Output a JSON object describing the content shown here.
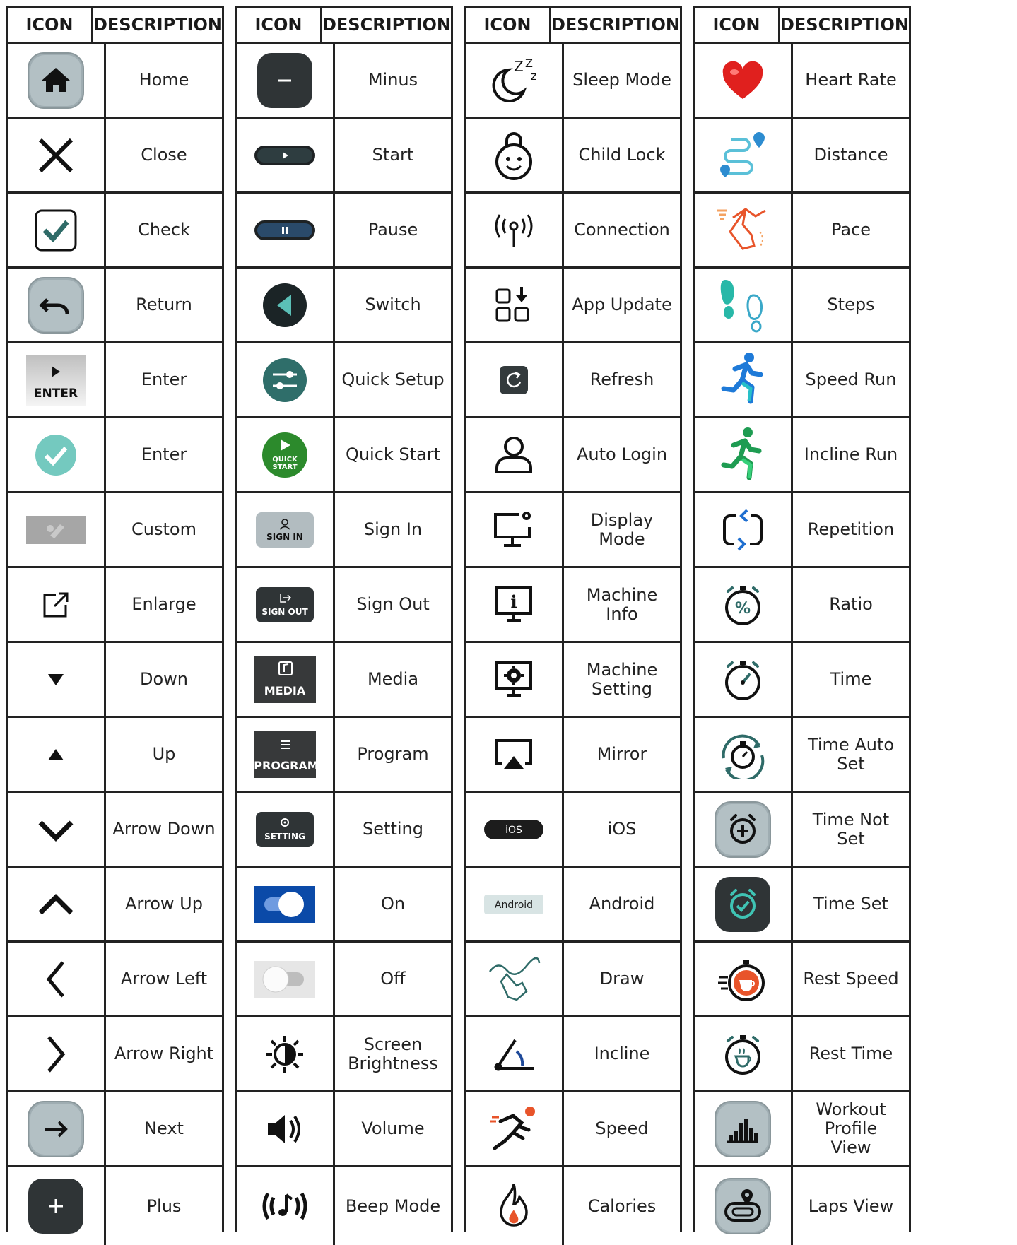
{
  "header": {
    "icon_label": "ICON",
    "description_label": "DESCRIPTION"
  },
  "colors": {
    "border": "#222222",
    "teal": "#2f6b68",
    "dark": "#333a3c",
    "grey_button": "#a7b3b7"
  },
  "columns": [
    {
      "rows": [
        {
          "icon": "home-icon",
          "label": "Home"
        },
        {
          "icon": "close-icon",
          "label": "Close"
        },
        {
          "icon": "check-icon",
          "label": "Check"
        },
        {
          "icon": "return-icon",
          "label": "Return"
        },
        {
          "icon": "enter-button-icon",
          "label": "Enter",
          "icon_text": "ENTER"
        },
        {
          "icon": "enter-check-icon",
          "label": "Enter"
        },
        {
          "icon": "custom-icon",
          "label": "Custom"
        },
        {
          "icon": "enlarge-icon",
          "label": "Enlarge"
        },
        {
          "icon": "down-triangle-icon",
          "label": "Down"
        },
        {
          "icon": "up-triangle-icon",
          "label": "Up"
        },
        {
          "icon": "arrow-down-icon",
          "label": "Arrow Down"
        },
        {
          "icon": "arrow-up-icon",
          "label": "Arrow Up"
        },
        {
          "icon": "arrow-left-icon",
          "label": "Arrow Left"
        },
        {
          "icon": "arrow-right-icon",
          "label": "Arrow Right"
        },
        {
          "icon": "next-icon",
          "label": "Next"
        },
        {
          "icon": "plus-icon",
          "label": "Plus"
        }
      ]
    },
    {
      "rows": [
        {
          "icon": "minus-icon",
          "label": "Minus"
        },
        {
          "icon": "start-icon",
          "label": "Start"
        },
        {
          "icon": "pause-icon",
          "label": "Pause"
        },
        {
          "icon": "switch-icon",
          "label": "Switch"
        },
        {
          "icon": "quick-setup-icon",
          "label": "Quick Setup"
        },
        {
          "icon": "quick-start-icon",
          "label": "Quick Start",
          "icon_text": "QUICK\nSTART"
        },
        {
          "icon": "sign-in-icon",
          "label": "Sign In",
          "icon_text": "SIGN IN"
        },
        {
          "icon": "sign-out-icon",
          "label": "Sign Out",
          "icon_text": "SIGN OUT"
        },
        {
          "icon": "media-icon",
          "label": "Media",
          "icon_text": "MEDIA"
        },
        {
          "icon": "program-icon",
          "label": "Program",
          "icon_text": "PROGRAM"
        },
        {
          "icon": "setting-icon",
          "label": "Setting",
          "icon_text": "SETTING"
        },
        {
          "icon": "toggle-on-icon",
          "label": "On"
        },
        {
          "icon": "toggle-off-icon",
          "label": "Off"
        },
        {
          "icon": "brightness-icon",
          "label": "Screen\nBrightness"
        },
        {
          "icon": "volume-icon",
          "label": "Volume"
        },
        {
          "icon": "beep-mode-icon",
          "label": "Beep Mode"
        }
      ]
    },
    {
      "rows": [
        {
          "icon": "sleep-mode-icon",
          "label": "Sleep Mode"
        },
        {
          "icon": "child-lock-icon",
          "label": "Child Lock"
        },
        {
          "icon": "connection-icon",
          "label": "Connection"
        },
        {
          "icon": "app-update-icon",
          "label": "App Update"
        },
        {
          "icon": "refresh-icon",
          "label": "Refresh"
        },
        {
          "icon": "auto-login-icon",
          "label": "Auto Login"
        },
        {
          "icon": "display-mode-icon",
          "label": "Display Mode"
        },
        {
          "icon": "machine-info-icon",
          "label": "Machine Info"
        },
        {
          "icon": "machine-setting-icon",
          "label": "Machine\nSetting"
        },
        {
          "icon": "mirror-icon",
          "label": "Mirror"
        },
        {
          "icon": "ios-icon",
          "label": "iOS",
          "icon_text": "iOS"
        },
        {
          "icon": "android-icon",
          "label": "Android",
          "icon_text": "Android"
        },
        {
          "icon": "draw-icon",
          "label": "Draw"
        },
        {
          "icon": "incline-icon",
          "label": "Incline"
        },
        {
          "icon": "speed-icon",
          "label": "Speed"
        },
        {
          "icon": "calories-icon",
          "label": "Calories"
        }
      ]
    },
    {
      "rows": [
        {
          "icon": "heart-rate-icon",
          "label": "Heart Rate"
        },
        {
          "icon": "distance-icon",
          "label": "Distance"
        },
        {
          "icon": "pace-icon",
          "label": "Pace"
        },
        {
          "icon": "steps-icon",
          "label": "Steps"
        },
        {
          "icon": "speed-run-icon",
          "label": "Speed Run"
        },
        {
          "icon": "incline-run-icon",
          "label": "Incline Run"
        },
        {
          "icon": "repetition-icon",
          "label": "Repetition"
        },
        {
          "icon": "ratio-icon",
          "label": "Ratio"
        },
        {
          "icon": "time-icon",
          "label": "Time"
        },
        {
          "icon": "time-auto-set-icon",
          "label": "Time Auto Set"
        },
        {
          "icon": "time-not-set-icon",
          "label": "Time Not Set"
        },
        {
          "icon": "time-set-icon",
          "label": "Time Set"
        },
        {
          "icon": "rest-speed-icon",
          "label": "Rest Speed"
        },
        {
          "icon": "rest-time-icon",
          "label": "Rest Time"
        },
        {
          "icon": "workout-profile-view-icon",
          "label": "Workout Profile\nView"
        },
        {
          "icon": "laps-view-icon",
          "label": "Laps View"
        }
      ]
    }
  ]
}
